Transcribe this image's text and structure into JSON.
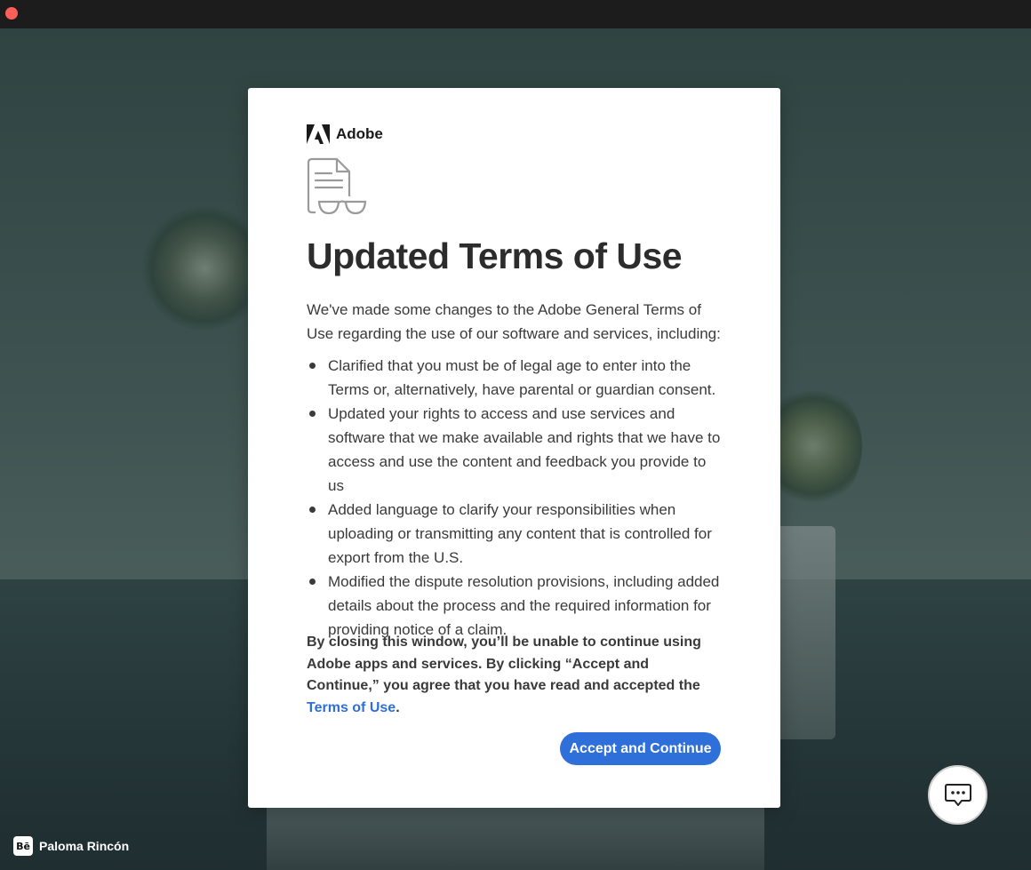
{
  "window": {
    "close_color": "#fe5f57"
  },
  "dialog": {
    "brand": "Adobe",
    "title": "Updated Terms of Use",
    "intro": "We've made some changes to the Adobe General Terms of Use regarding the use of our software and services, including:",
    "bullets": [
      "Clarified that you must be of legal age to enter into the Terms or, alternatively, have parental or guardian consent.",
      "Updated your rights to access and use services and software that we make available and rights that we have to access and use the content and feedback you provide to us",
      "Added language to clarify your responsibilities when uploading or transmitting any content that is controlled for export from the U.S.",
      "Modified the dispute resolution provisions, including added details about the process and the required information for providing notice of a claim."
    ],
    "notice_text": "By closing this window, you’ll be unable to continue using Adobe apps and services. By clicking “Accept and Continue,” you agree that you have read and accepted the ",
    "notice_link": "Terms of Use",
    "notice_end": ".",
    "accept_label": "Accept and Continue",
    "accent_color": "#2f6fd9"
  },
  "credit": {
    "icon": "behance-icon",
    "name": "Paloma Rincón"
  },
  "chat": {
    "icon": "chat-icon"
  }
}
